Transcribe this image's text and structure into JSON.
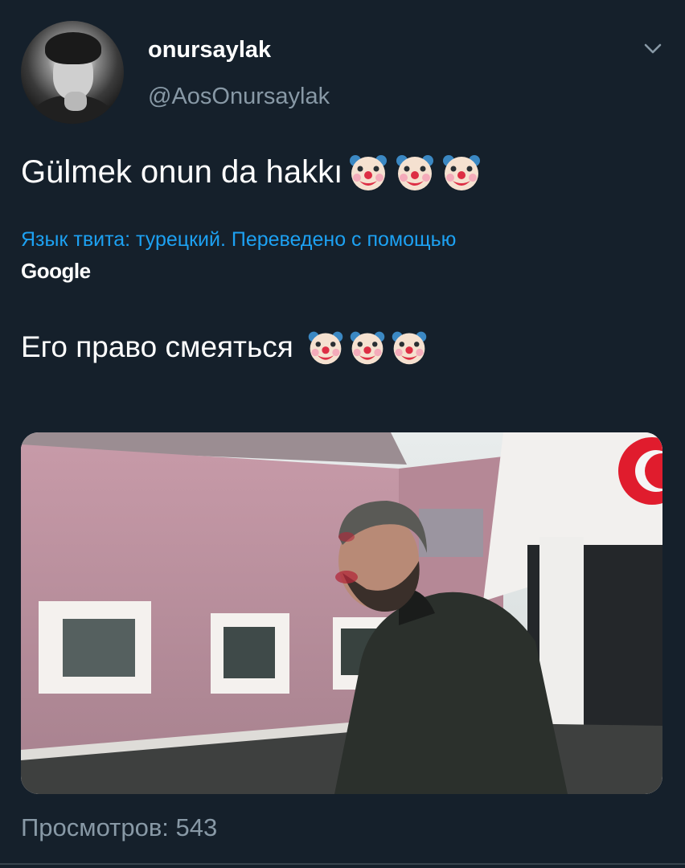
{
  "tweet": {
    "display_name": "onursaylak",
    "handle": "@AosOnursaylak",
    "text": "Gülmek onun da hakkı",
    "text_emoji_count": 3,
    "translation_note": "Язык твита: турецкий. Переведено с помощью",
    "translation_provider": "Google",
    "translated_text": "Его право смеяться",
    "translated_emoji_count": 3,
    "views": "Просмотров: 543"
  },
  "icons": {
    "menu": "chevron-down-icon",
    "emoji": "clown-face-emoji"
  },
  "colors": {
    "background": "#15202b",
    "link": "#1da1f2",
    "secondary_text": "#8899a6"
  }
}
